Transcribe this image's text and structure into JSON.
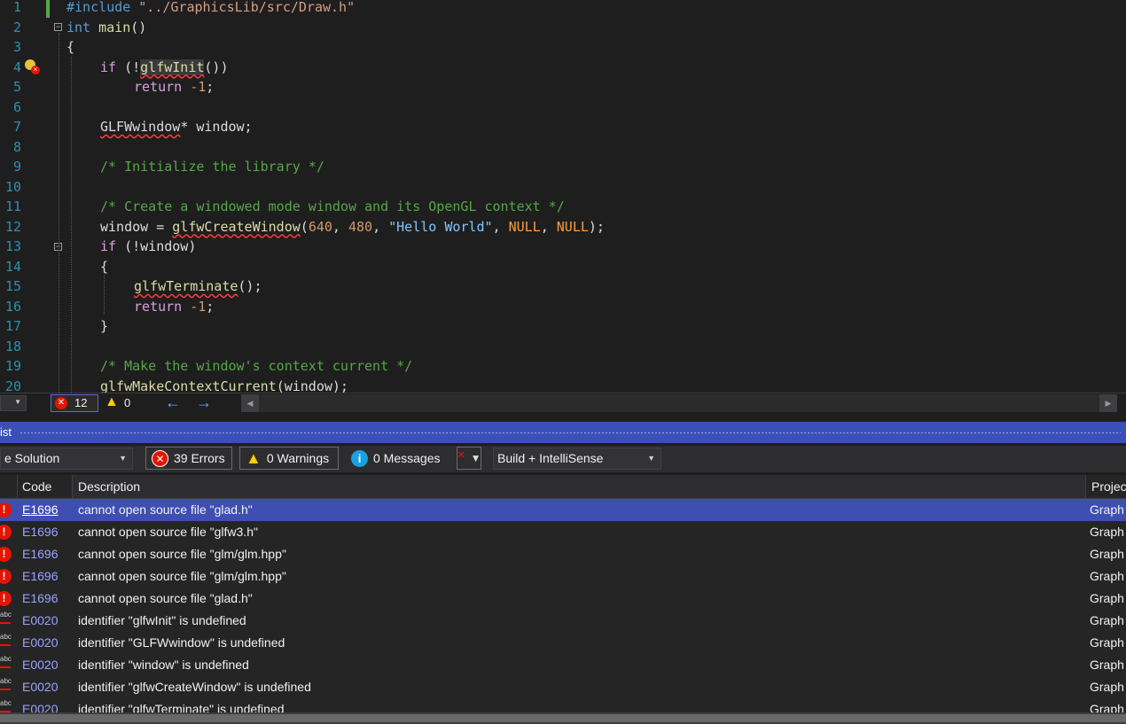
{
  "editor": {
    "line_numbers": [
      "1",
      "2",
      "3",
      "4",
      "5",
      "6",
      "7",
      "8",
      "9",
      "10",
      "11",
      "12",
      "13",
      "14",
      "15",
      "16",
      "17",
      "18",
      "19",
      "20"
    ],
    "l1_pp": "#include",
    "l1_str": " \"../GraphicsLib/src/Draw.h\"",
    "l2_kw": "int",
    "l2_fn": " main",
    "l2_rest": "()",
    "l3": "{",
    "l4_kw": "if",
    "l4_a": " (!",
    "l4_fn": "glfwInit",
    "l4_b": "())",
    "l5_kw": "return",
    "l5_sp": " ",
    "l5_num": "-1",
    "l5_semi": ";",
    "l7_type": "GLFWwindow",
    "l7_rest": "* window;",
    "l9_cmt": "/* Initialize the library */",
    "l11_cmt": "/* Create a windowed mode window and its OpenGL context */",
    "l12_a": "window = ",
    "l12_fn": "glfwCreateWindow",
    "l12_b": "(",
    "l12_n1": "640",
    "l12_c": ", ",
    "l12_n2": "480",
    "l12_d": ", ",
    "l12_str": "\"Hello World\"",
    "l12_e": ", ",
    "l12_null1": "NULL",
    "l12_f": ", ",
    "l12_null2": "NULL",
    "l12_g": ");",
    "l13_kw": "if",
    "l13_rest": " (!window)",
    "l14": "{",
    "l15_fn": "glfwTerminate",
    "l15_rest": "();",
    "l16_kw": "return",
    "l16_sp": " ",
    "l16_num": "-1",
    "l16_semi": ";",
    "l17": "}",
    "l19_cmt": "/* Make the window's context current */",
    "l20_fn": "glfwMakeContextCurrent",
    "l20_rest": "(window);"
  },
  "editor_status": {
    "error_count": "12",
    "warning_count": "0"
  },
  "panel": {
    "title": "ist"
  },
  "toolbar": {
    "scope": "e Solution",
    "errors_label": "39 Errors",
    "warnings_label": "0 Warnings",
    "messages_label": "0 Messages",
    "build_filter": "Build + IntelliSense"
  },
  "grid": {
    "headers": {
      "code": "Code",
      "description": "Description",
      "project": "Projec"
    },
    "rows": [
      {
        "code": "E1696",
        "description": "cannot open source file \"glad.h\"",
        "project": "Graph"
      },
      {
        "code": "E1696",
        "description": "cannot open source file \"glfw3.h\"",
        "project": "Graph"
      },
      {
        "code": "E1696",
        "description": "cannot open source file \"glm/glm.hpp\"",
        "project": "Graph"
      },
      {
        "code": "E1696",
        "description": "cannot open source file \"glm/glm.hpp\"",
        "project": "Graph"
      },
      {
        "code": "E1696",
        "description": "cannot open source file \"glad.h\"",
        "project": "Graph"
      },
      {
        "code": "E0020",
        "description": "identifier \"glfwInit\" is undefined",
        "project": "Graph"
      },
      {
        "code": "E0020",
        "description": "identifier \"GLFWwindow\" is undefined",
        "project": "Graph"
      },
      {
        "code": "E0020",
        "description": "identifier \"window\" is undefined",
        "project": "Graph"
      },
      {
        "code": "E0020",
        "description": "identifier \"glfwCreateWindow\" is undefined",
        "project": "Graph"
      },
      {
        "code": "E0020",
        "description": "identifier \"glfwTerminate\" is undefined",
        "project": "Graph"
      }
    ]
  },
  "icons": {
    "error_icon": "error-circle-icon",
    "warning_icon": "warning-triangle-icon",
    "info_icon": "info-circle-icon",
    "spell_icon": "abc-squiggle-icon"
  },
  "colors": {
    "accent": "#3f4eb1",
    "error": "#e51400",
    "warning": "#ffcc00",
    "info": "#1ba1e2"
  }
}
